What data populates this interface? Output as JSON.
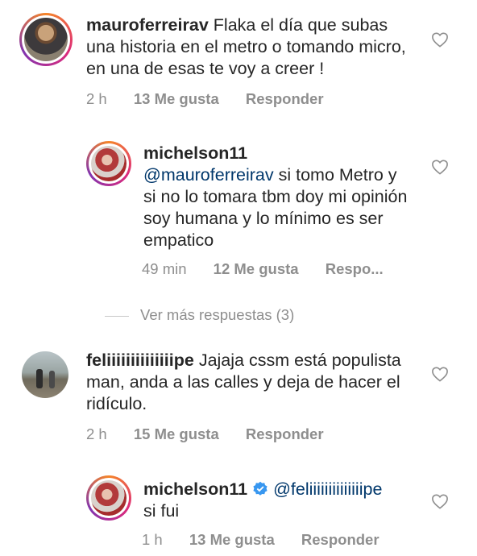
{
  "comments": [
    {
      "username": "mauroferreirav",
      "text": "Flaka el día que subas una historia en el metro o tomando micro,  en una de esas te voy a creer !",
      "time": "2 h",
      "likes": "13 Me gusta",
      "reply": "Responder"
    },
    {
      "username": "michelson11",
      "mention": "@mauroferreirav",
      "text": " si tomo Metro y si no lo tomara tbm doy mi opinión soy humana y lo mínimo es ser empatico",
      "time": "49 min",
      "likes": "12 Me gusta",
      "reply": "Respo..."
    },
    {
      "username": "feliiiiiiiiiiiiiipe",
      "text": "Jajaja cssm está populista man, anda a las calles y deja de hacer el ridículo.",
      "time": "2 h",
      "likes": "15 Me gusta",
      "reply": "Responder"
    },
    {
      "username": "michelson11",
      "mention": "@feliiiiiiiiiiiiiipe",
      "text": "si fui",
      "time": "1 h",
      "likes": "13 Me gusta",
      "reply": "Responder"
    }
  ],
  "more_replies": "Ver más respuestas (3)",
  "colors": {
    "mention": "#00376b",
    "meta": "#8e8e8e",
    "verified": "#3897f0"
  }
}
